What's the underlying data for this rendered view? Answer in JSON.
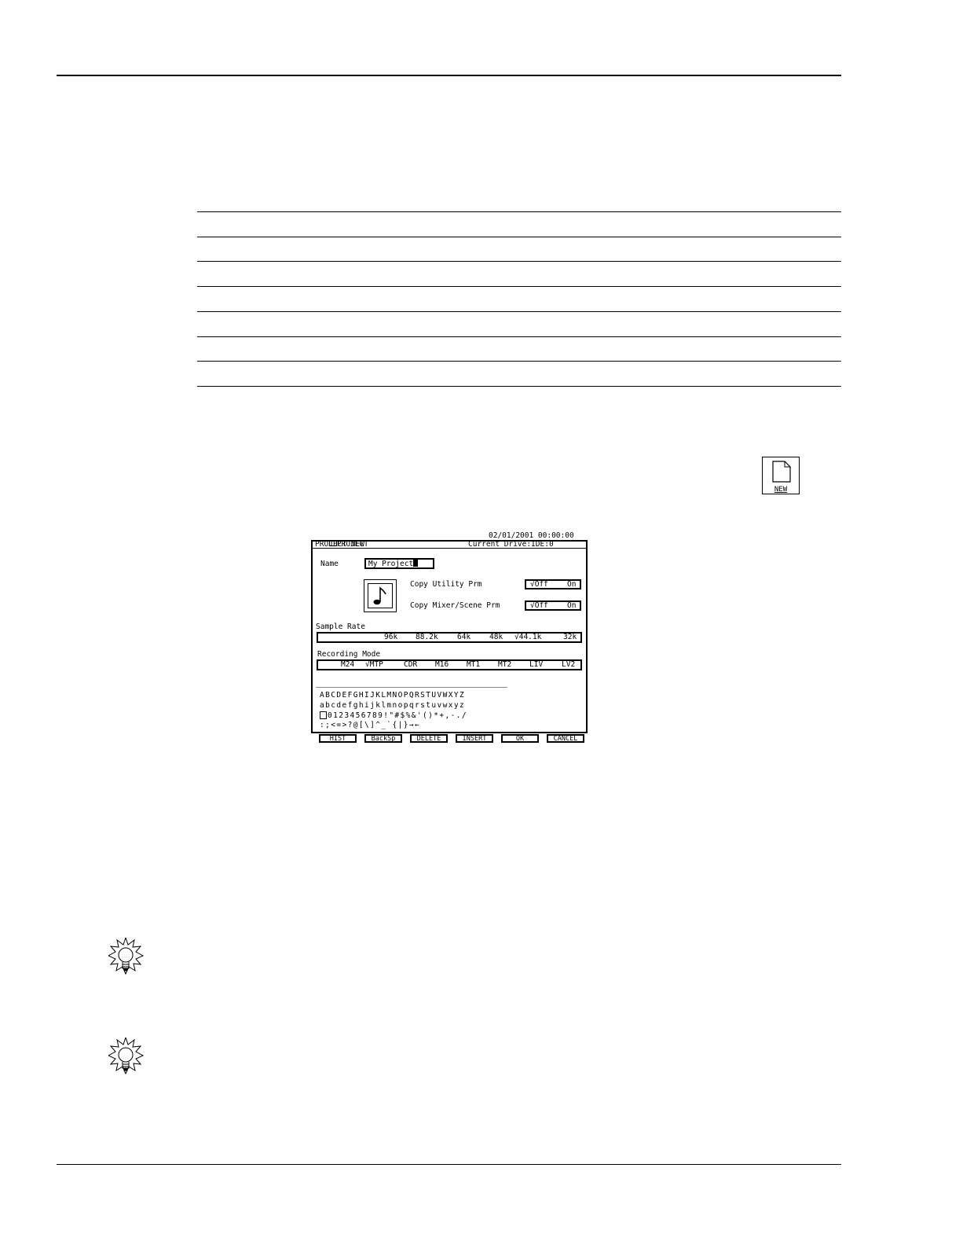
{
  "new_icon": {
    "label": "NEW"
  },
  "lcd": {
    "page_tab": "PROJECT",
    "datetime": "02/01/2001 00:00:00",
    "title": "PROJECT NEW",
    "current_drive": "Current Drive:IDE:0",
    "name_label": "Name",
    "name_value": "My Project",
    "copy_utility_label": "Copy Utility Prm",
    "copy_utility_off": "√Off",
    "copy_utility_on": "On",
    "copy_mixer_label": "Copy Mixer/Scene Prm",
    "copy_mixer_off": "√Off",
    "copy_mixer_on": "On",
    "sample_rate_label": "Sample Rate",
    "sample_rates": [
      "96k",
      "88.2k",
      "64k",
      "48k",
      "√44.1k",
      "32k"
    ],
    "recording_mode_label": "Recording Mode",
    "recording_modes": [
      "M24",
      "√MTP",
      "CDR",
      "M16",
      "MT1",
      "MT2",
      "LIV",
      "LV2"
    ],
    "char_rows": [
      "ABCDEFGHIJKLMNOPQRSTUVWXYZ",
      "abcdefghijklmnopqrstuvwxyz",
      "0123456789!\"#$%&'()*+,-./",
      ":;<=>?@[\\]^_`{|}→←"
    ],
    "function_keys": [
      "HIST",
      "BackSp",
      "DELETE",
      "INSERT",
      "OK",
      "CANCEL"
    ]
  }
}
